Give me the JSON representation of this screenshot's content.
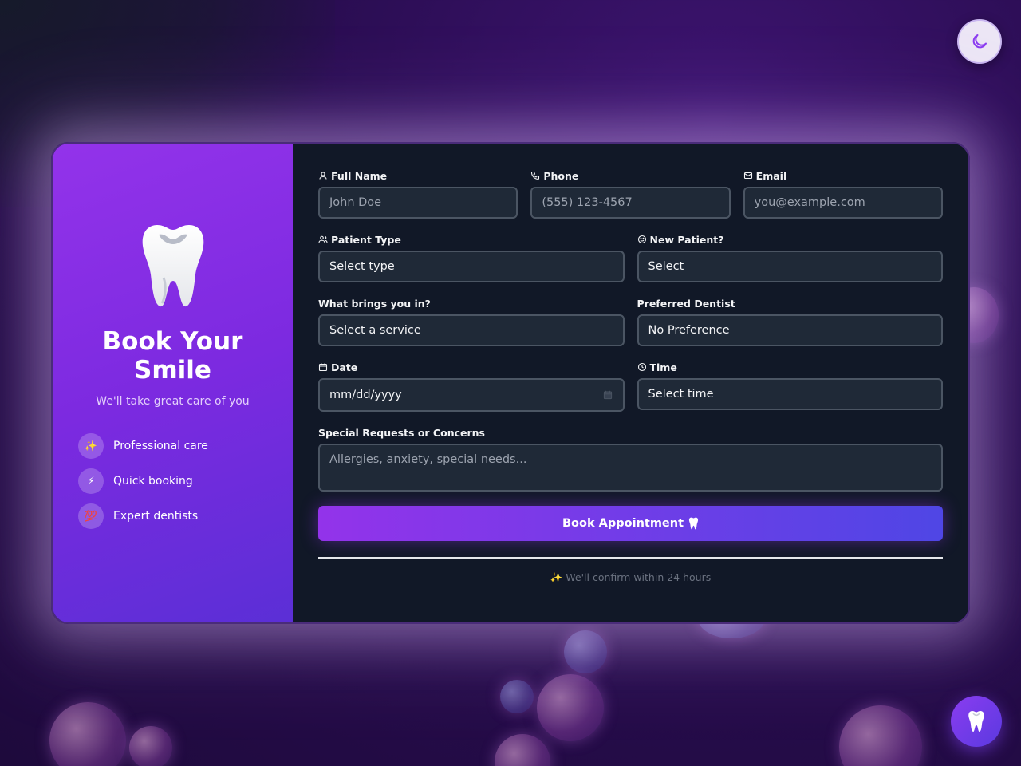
{
  "theme_toggle": {
    "icon": "moon-icon"
  },
  "fab": {
    "icon": "tooth-icon"
  },
  "hero": {
    "icon": "tooth-icon",
    "title": "Book Your Smile",
    "subtitle": "We'll take great care of you",
    "features": [
      {
        "icon": "sparkles-icon",
        "glyph": "✨",
        "label": "Professional care"
      },
      {
        "icon": "lightning-icon",
        "glyph": "⚡",
        "label": "Quick booking"
      },
      {
        "icon": "hundred-points-icon",
        "glyph": "💯",
        "label": "Expert dentists"
      }
    ]
  },
  "form": {
    "full_name": {
      "label": "Full Name",
      "placeholder": "John Doe",
      "icon": "user-icon"
    },
    "phone": {
      "label": "Phone",
      "placeholder": "(555) 123-4567",
      "icon": "phone-icon"
    },
    "email": {
      "label": "Email",
      "placeholder": "you@example.com",
      "icon": "mail-icon"
    },
    "patient_type": {
      "label": "Patient Type",
      "value": "Select type",
      "icon": "users-icon"
    },
    "new_patient": {
      "label": "New Patient?",
      "value": "Select",
      "icon": "smile-icon"
    },
    "service": {
      "label": "What brings you in?",
      "value": "Select a service"
    },
    "dentist": {
      "label": "Preferred Dentist",
      "value": "No Preference"
    },
    "date": {
      "label": "Date",
      "placeholder": "mm/dd/yyyy",
      "icon": "calendar-icon"
    },
    "time": {
      "label": "Time",
      "value": "Select time",
      "icon": "clock-icon"
    },
    "requests": {
      "label": "Special Requests or Concerns",
      "placeholder": "Allergies, anxiety, special needs..."
    },
    "submit": {
      "label": "Book Appointment",
      "icon": "tooth-icon"
    },
    "footnote": "✨ We'll confirm within 24 hours"
  },
  "colors": {
    "accent": "#9333ea",
    "accent_end": "#4f46e5",
    "panel": "#111827",
    "field_bg": "#1f2937"
  }
}
